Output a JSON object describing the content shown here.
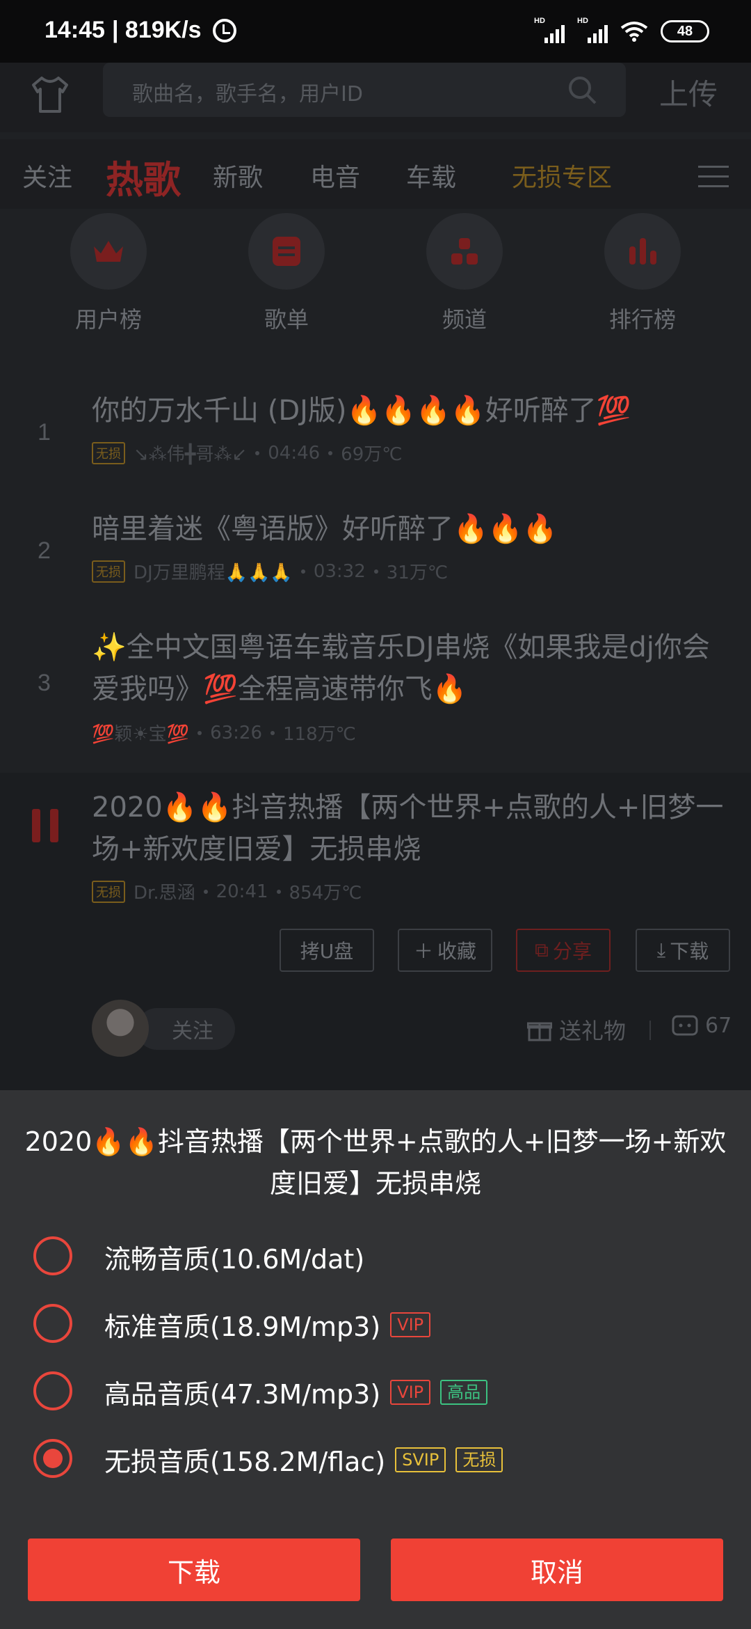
{
  "status_bar": {
    "time": "14:45",
    "net_speed": "| 819K/s",
    "hd1": "HD",
    "hd2": "HD",
    "battery": "48"
  },
  "header": {
    "search_placeholder": "歌曲名，歌手名，用户ID",
    "upload_label": "上传"
  },
  "tabs": [
    {
      "label": "关注"
    },
    {
      "label": "热歌"
    },
    {
      "label": "新歌"
    },
    {
      "label": "电音"
    },
    {
      "label": "车载"
    },
    {
      "label": "无损专区"
    }
  ],
  "categories": [
    {
      "label": "用户榜",
      "icon": "crown-icon"
    },
    {
      "label": "歌单",
      "icon": "playlist-icon"
    },
    {
      "label": "频道",
      "icon": "channel-icon"
    },
    {
      "label": "排行榜",
      "icon": "chart-bars-icon"
    }
  ],
  "songs": [
    {
      "rank": "1",
      "title": "你的万水千山 (DJ版)🔥🔥🔥🔥好听醉了💯",
      "badge": "无损",
      "uploader": "↘⁂伟╋哥⁂↙",
      "duration": "04:46",
      "heat": "69万℃"
    },
    {
      "rank": "2",
      "title": "暗里着迷《粤语版》好听醉了🔥🔥🔥",
      "badge": "无损",
      "uploader": "DJ万里鹏程🙏🙏🙏",
      "duration": "03:32",
      "heat": "31万℃"
    },
    {
      "rank": "3",
      "title": "✨全中文国粤语车载音乐DJ串烧《如果我是dj你会爱我吗》💯全程高速带你飞🔥",
      "uploader": "💯颖☀宝💯",
      "duration": "63:26",
      "heat": "118万℃"
    },
    {
      "title": "2020🔥🔥抖音热播【两个世界+点歌的人+旧梦一场+新欢度旧爱】无损串烧",
      "badge": "无损",
      "uploader": "Dr.思涵",
      "duration": "20:41",
      "heat": "854万℃"
    }
  ],
  "song_actions": {
    "usb": "拷U盘",
    "collect": "收藏",
    "share": "分享",
    "download": "下载"
  },
  "social": {
    "follow": "关注",
    "gift": "送礼物",
    "comments": "67"
  },
  "sheet": {
    "title": "2020🔥🔥抖音热播【两个世界+点歌的人+旧梦一场+新欢度旧爱】无损串烧",
    "options": [
      {
        "label": "流畅音质(10.6M/dat)",
        "tags": [],
        "selected": false
      },
      {
        "label": "标准音质(18.9M/mp3)",
        "tags": [
          "VIP"
        ],
        "selected": false
      },
      {
        "label": "高品音质(47.3M/mp3)",
        "tags": [
          "VIP",
          "高品"
        ],
        "selected": false
      },
      {
        "label": "无损音质(158.2M/flac)",
        "tags": [
          "SVIP",
          "无损"
        ],
        "selected": true
      }
    ],
    "download_label": "下载",
    "cancel_label": "取消"
  },
  "colors": {
    "accent": "#f04135",
    "radio": "#e9463c",
    "svip": "#e8c13a",
    "hq": "#3cc281"
  }
}
